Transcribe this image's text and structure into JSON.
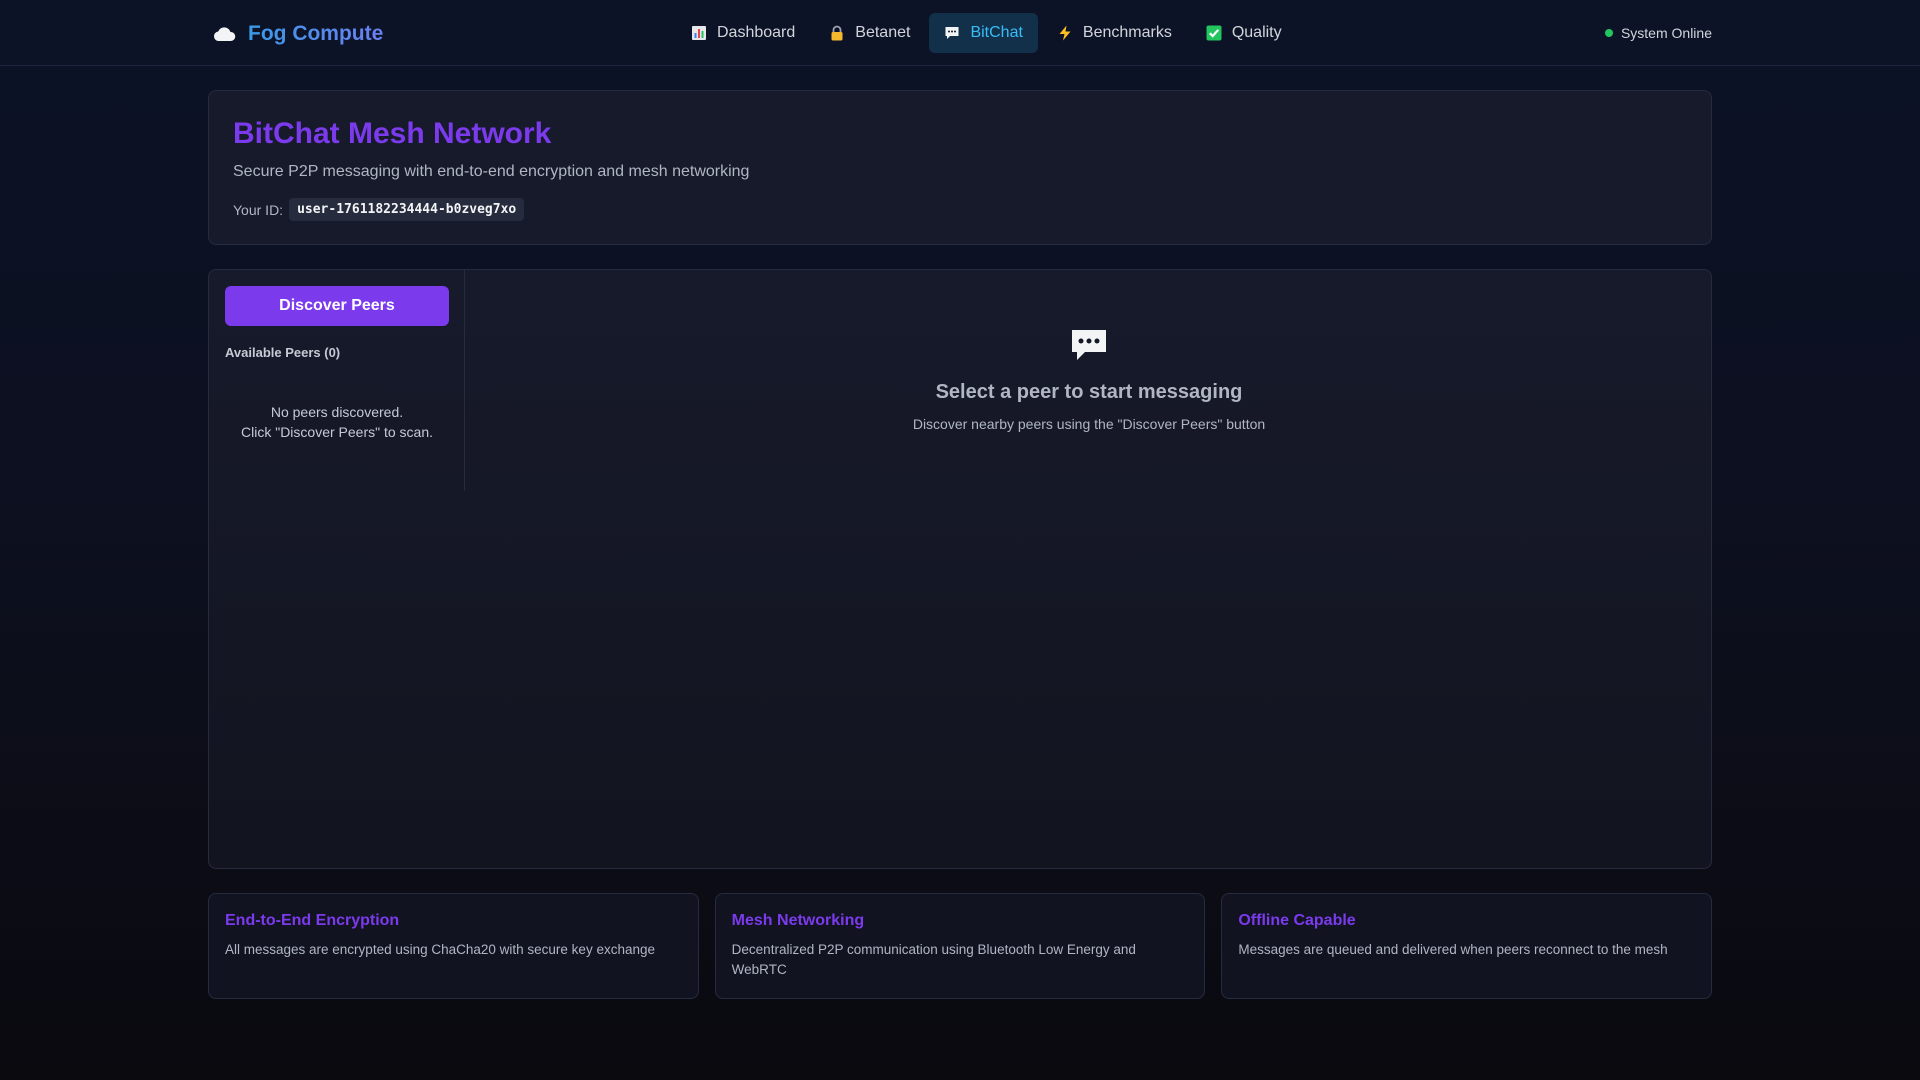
{
  "brand": {
    "name": "Fog Compute",
    "icon": "cloud-icon"
  },
  "nav": {
    "items": [
      {
        "label": "Dashboard",
        "icon": "bar-chart-icon",
        "active": false
      },
      {
        "label": "Betanet",
        "icon": "lock-icon",
        "active": false
      },
      {
        "label": "BitChat",
        "icon": "chat-bubble-icon",
        "active": true
      },
      {
        "label": "Benchmarks",
        "icon": "lightning-icon",
        "active": false
      },
      {
        "label": "Quality",
        "icon": "check-box-icon",
        "active": false
      }
    ]
  },
  "status": {
    "label": "System Online",
    "color": "#22c55e"
  },
  "header": {
    "title": "BitChat Mesh Network",
    "subtitle": "Secure P2P messaging with end-to-end encryption and mesh networking",
    "id_label": "Your ID:",
    "id_value": "user-1761182234444-b0zveg7xo"
  },
  "sidebar": {
    "discover_button": "Discover Peers",
    "peers_heading": "Available Peers (0)",
    "empty_line1": "No peers discovered.",
    "empty_line2": "Click \"Discover Peers\" to scan."
  },
  "chat": {
    "empty_title": "Select a peer to start messaging",
    "empty_subtitle": "Discover nearby peers using the \"Discover Peers\" button"
  },
  "features": [
    {
      "title": "End-to-End Encryption",
      "description": "All messages are encrypted using ChaCha20 with secure key exchange"
    },
    {
      "title": "Mesh Networking",
      "description": "Decentralized P2P communication using Bluetooth Low Energy and WebRTC"
    },
    {
      "title": "Offline Capable",
      "description": "Messages are queued and delivered when peers reconnect to the mesh"
    }
  ],
  "colors": {
    "accent": "#7c3aed",
    "nav_active_text": "#38bdf8",
    "background": "#0d1020"
  }
}
